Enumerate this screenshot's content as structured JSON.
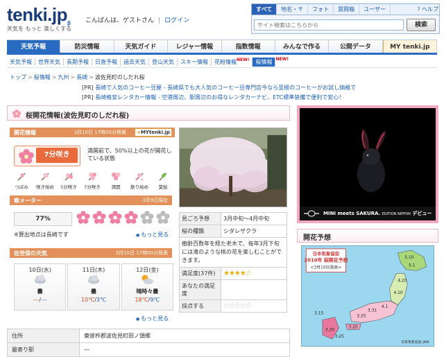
{
  "header": {
    "logo": "tenki.jp",
    "logo_suffix": "β",
    "tagline": "天気を もっと 楽しくする",
    "greeting": "こんばんは、ゲストさん",
    "separator": "|",
    "login": "ログイン",
    "help": "ヘルプ"
  },
  "search": {
    "tabs": [
      "すべて",
      "地名・〒",
      "フォト",
      "質問箱",
      "ユーザー"
    ],
    "placeholder": "サイト検索はこちらから",
    "button": "検索"
  },
  "main_nav": [
    "天気予報",
    "防災情報",
    "天気ガイド",
    "レジャー情報",
    "指数情報",
    "みんなで作る",
    "公開データ",
    "MY tenki.jp"
  ],
  "sub_nav": [
    {
      "label": "天気予報",
      "new": ""
    },
    {
      "label": "世界天気",
      "new": ""
    },
    {
      "label": "長期予報",
      "new": ""
    },
    {
      "label": "日直予報",
      "new": ""
    },
    {
      "label": "過去天気",
      "new": ""
    },
    {
      "label": "登山天気",
      "new": ""
    },
    {
      "label": "スキー情報",
      "new": ""
    },
    {
      "label": "花粉情報",
      "new": "NEW!"
    },
    {
      "label": "桜情報",
      "new": "NEW!"
    }
  ],
  "breadcrumb": [
    "トップ",
    "桜情報",
    "九州",
    "長崎",
    "波佐見町のしだれ桜"
  ],
  "breadcrumb_sep": ">",
  "ads_text": [
    {
      "tag": "[PR]",
      "text": "長崎で人気のコーヒー豆屋 - 長崎県でも大人気のコーヒー豆専門店今なら至極のコーヒーがお試し価格で"
    },
    {
      "tag": "[PR]",
      "text": "長崎格安レンタカー情報 - 空港周辺、駅周辺のお得なレンタカーナビ、ETC標準装備で便利で安心！"
    }
  ],
  "sakura": {
    "title": "桜開花情報(波佐見町のしだれ桜)",
    "info_header": "開花情報",
    "info_date": "3月10日 17時00分発表",
    "mytenki_badge_prefix": "+",
    "mytenki_badge": "MYtenki.jp",
    "bloom_level": "7分咲き",
    "bloom_desc": "満開前で、50%以上の花が開花している状態",
    "stages": [
      "つぼみ",
      "咲き始め",
      "5分咲き",
      "7分咲き",
      "満開",
      "散り始め",
      "葉桜"
    ],
    "meter_header": "春メーター",
    "meter_date": "3月9日現在",
    "meter_percent": "77%",
    "meter_flowers_on": 4,
    "meter_flowers_total": 6,
    "calc_note": "※算出地点は長崎です",
    "more": "もっと見る",
    "weather_header": "佐世保の天気",
    "weather_date": "3月10日 17時00分発表",
    "days": [
      {
        "date": "10日(水)",
        "weather": "曇",
        "hi": "---",
        "lo": "---",
        "icon": "cloud-icon"
      },
      {
        "date": "11日(木)",
        "weather": "曇",
        "hi": "10℃",
        "lo": "3℃",
        "icon": "cloud-icon"
      },
      {
        "date": "12日(金)",
        "weather": "晴時々曇",
        "hi": "18℃",
        "lo": "9℃",
        "icon": "sun-cloud-icon"
      }
    ],
    "temp_sep": "/",
    "info_rows": [
      {
        "key": "見ごろ予想",
        "value": "3月中旬～4月中旬"
      },
      {
        "key": "桜の種類",
        "value": "シダレザクラ"
      }
    ],
    "description": "樹齢百数年を経た老木で、毎年3月下旬には滝のような桃の花を楽しむことができます。",
    "rating_rows": [
      {
        "key": "満足度(37件)",
        "stars": 4.5
      },
      {
        "key": "あなたの満足度",
        "stars": -1
      },
      {
        "key": "採点する",
        "stars": 0
      }
    ],
    "address_rows": [
      {
        "key": "住所",
        "value": "東彼杵郡波佐見町田ノ頭郷"
      },
      {
        "key": "最寄り駅",
        "value": "―"
      }
    ]
  },
  "right": {
    "ad_caption": "MINI meets SAKURA.",
    "ad_edition": "EDITION NIPPON",
    "ad_suffix": "デビュー",
    "forecast_title": "開花予想",
    "map_org": "日本気象協会",
    "map_title": "2010年 桜開花予想",
    "map_date": "<3月10日発表>",
    "map_dates": [
      "5.10",
      "5.1",
      "4.20",
      "4.10",
      "4.1",
      "3.31",
      "3.25",
      "3.20",
      "3.15",
      "3.20",
      "3.25"
    ],
    "map_credit": "日本気象協会 JWA"
  },
  "colors": {
    "brand_blue": "#2a6bc2",
    "section_orange": "#e4905b",
    "bloom_red": "#e96a3b",
    "pink_border": "#f3a8c2"
  }
}
